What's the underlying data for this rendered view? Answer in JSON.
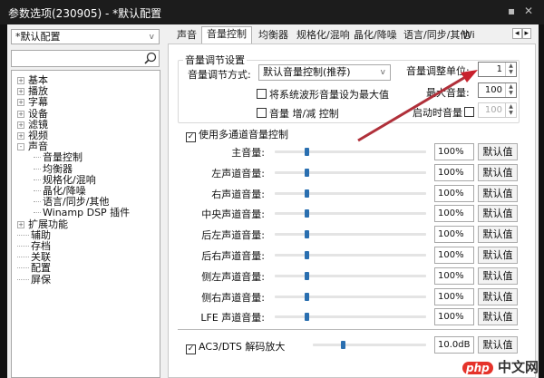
{
  "window": {
    "title": "参数选项(230905) - *默认配置",
    "min": "▪",
    "close": "✕"
  },
  "sidebar": {
    "profile": "*默认配置",
    "search_placeholder": "",
    "tree": [
      {
        "label": "基本",
        "exp": "+",
        "lvl": 0
      },
      {
        "label": "播放",
        "exp": "+",
        "lvl": 0
      },
      {
        "label": "字幕",
        "exp": "+",
        "lvl": 0
      },
      {
        "label": "设备",
        "exp": "+",
        "lvl": 0
      },
      {
        "label": "滤镜",
        "exp": "+",
        "lvl": 0
      },
      {
        "label": "视频",
        "exp": "+",
        "lvl": 0
      },
      {
        "label": "声音",
        "exp": "-",
        "lvl": 0
      },
      {
        "label": "音量控制",
        "lvl": 1
      },
      {
        "label": "均衡器",
        "lvl": 1
      },
      {
        "label": "规格化/混响",
        "lvl": 1
      },
      {
        "label": "晶化/降噪",
        "lvl": 1
      },
      {
        "label": "语言/同步/其他",
        "lvl": 1
      },
      {
        "label": "Winamp DSP 插件",
        "lvl": 1
      },
      {
        "label": "扩展功能",
        "exp": "+",
        "lvl": 0
      },
      {
        "label": "辅助",
        "lvl": 0
      },
      {
        "label": "存档",
        "lvl": 0
      },
      {
        "label": "关联",
        "lvl": 0
      },
      {
        "label": "配置",
        "lvl": 0
      },
      {
        "label": "屏保",
        "lvl": 0
      }
    ]
  },
  "tabs": [
    "声音",
    "音量控制",
    "均衡器",
    "规格化/混响",
    "晶化/降噪",
    "语言/同步/其他",
    "Wi"
  ],
  "tab_scroll": {
    "left": "◂",
    "right": "▸"
  },
  "group": {
    "title": "音量调节设置",
    "mode_label": "音量调节方式:",
    "mode_value": "默认音量控制(推荐)",
    "cb_system": "将系统波形音量设为最大值",
    "cb_incdec": "音量 增/减 控制",
    "unit_label": "音量调整单位:",
    "unit_value": "1",
    "max_label": "最大音量:",
    "max_value": "100",
    "startup_label": "启动时音量",
    "startup_value": "100"
  },
  "multichannel": {
    "label": "使用多通道音量控制",
    "checked": true,
    "channels": [
      {
        "label": "主音量:",
        "value": "100%",
        "level": 0.2
      },
      {
        "label": "左声道音量:",
        "value": "100%",
        "level": 0.2
      },
      {
        "label": "右声道音量:",
        "value": "100%",
        "level": 0.2
      },
      {
        "label": "中央声道音量:",
        "value": "100%",
        "level": 0.2
      },
      {
        "label": "后左声道音量:",
        "value": "100%",
        "level": 0.2
      },
      {
        "label": "后右声道音量:",
        "value": "100%",
        "level": 0.2
      },
      {
        "label": "侧左声道音量:",
        "value": "100%",
        "level": 0.2
      },
      {
        "label": "侧右声道音量:",
        "value": "100%",
        "level": 0.2
      },
      {
        "label": "LFE 声道音量:",
        "value": "100%",
        "level": 0.2
      }
    ],
    "default_label": "默认值"
  },
  "ac3": {
    "label": "AC3/DTS 解码放大",
    "value": "10.0dB",
    "level": 0.25,
    "default_label": "默认值"
  },
  "watermark": {
    "a": "php",
    "b": "中文网"
  }
}
